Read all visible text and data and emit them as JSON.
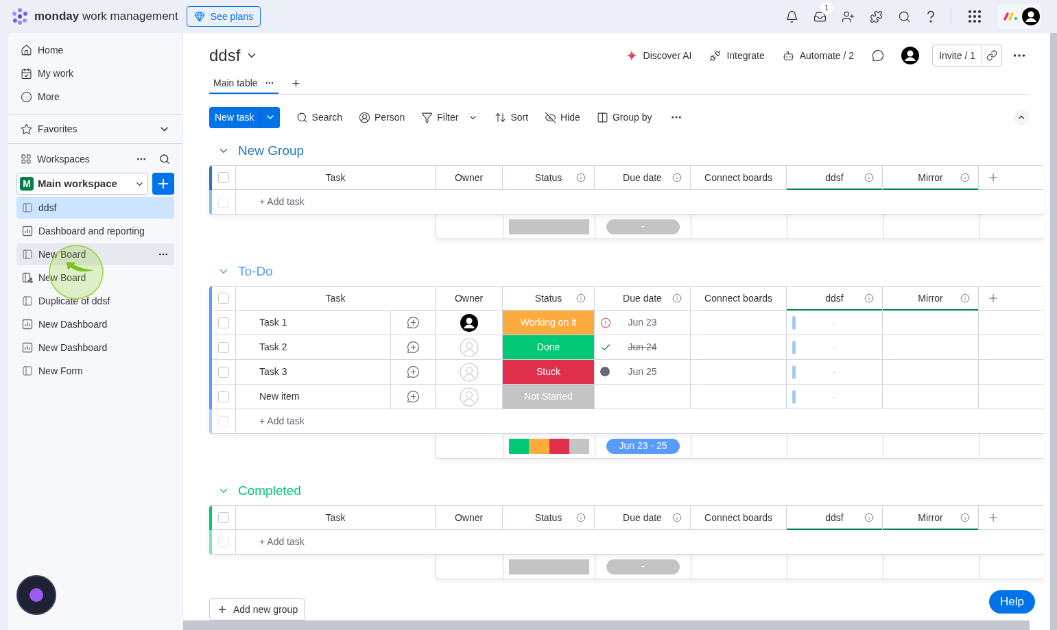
{
  "topbar": {
    "brand_bold": "monday",
    "brand_rest": "work management",
    "see_plans": "See plans",
    "inbox_badge": "1"
  },
  "sidebar": {
    "nav": [
      {
        "label": "Home",
        "kind": "home"
      },
      {
        "label": "My work",
        "kind": "mywork"
      },
      {
        "label": "More",
        "kind": "more"
      }
    ],
    "favorites": "Favorites",
    "workspaces": "Workspaces",
    "workspace": {
      "initial": "M",
      "name": "Main workspace"
    },
    "boards": [
      {
        "label": "ddsf",
        "kind": "board",
        "selected": true,
        "hovered": false
      },
      {
        "label": "Dashboard and reporting",
        "kind": "dashboard",
        "selected": false,
        "hovered": false
      },
      {
        "label": "New Board",
        "kind": "board",
        "selected": false,
        "hovered": true
      },
      {
        "label": "New Board",
        "kind": "shared",
        "selected": false,
        "hovered": false
      },
      {
        "label": "Duplicate of ddsf",
        "kind": "board",
        "selected": false,
        "hovered": false
      },
      {
        "label": "New Dashboard",
        "kind": "dashboard",
        "selected": false,
        "hovered": false
      },
      {
        "label": "New Dashboard",
        "kind": "dashboard",
        "selected": false,
        "hovered": false
      },
      {
        "label": "New Form",
        "kind": "board",
        "selected": false,
        "hovered": false
      }
    ]
  },
  "board": {
    "title": "ddsf",
    "actions": [
      {
        "label": "Discover AI",
        "kind": "ai"
      },
      {
        "label": "Integrate",
        "kind": "integrate"
      },
      {
        "label": "Automate / 2",
        "kind": "automate"
      }
    ],
    "invite": "Invite / 1",
    "tabs": [
      {
        "label": "Main table",
        "selected": true
      }
    ]
  },
  "toolbar": {
    "new_task": "New task",
    "tools": [
      {
        "label": "Search",
        "kind": "search"
      },
      {
        "label": "Person",
        "kind": "person"
      },
      {
        "label": "Filter",
        "kind": "filter"
      },
      {
        "label": "Sort",
        "kind": "sort"
      },
      {
        "label": "Hide",
        "kind": "hide"
      },
      {
        "label": "Group by",
        "kind": "groupby"
      }
    ]
  },
  "groups": [
    {
      "title": "New Group",
      "color": "#1f76c2",
      "all_checked": false,
      "add_row_disabled": true,
      "columns": [
        {
          "label": "Task",
          "info": false
        },
        {
          "label": "Owner",
          "info": false
        },
        {
          "label": "Status",
          "info": true
        },
        {
          "label": "Due date",
          "info": true
        },
        {
          "label": "Connect boards",
          "info": false
        },
        {
          "label": "ddsf",
          "info": true
        },
        {
          "label": "Mirror",
          "info": true
        }
      ],
      "add_task": "+ Add task",
      "summary": {
        "status_segments": [
          {
            "color": "#c4c4c4"
          }
        ],
        "date": {
          "label": "-",
          "color": "#c4c4c4"
        }
      }
    },
    {
      "title": "To-Do",
      "color": "#579bfc",
      "all_checked": false,
      "add_row_disabled": true,
      "columns": [
        {
          "label": "Task",
          "info": false
        },
        {
          "label": "Owner",
          "info": false
        },
        {
          "label": "Status",
          "info": true
        },
        {
          "label": "Due date",
          "info": true
        },
        {
          "label": "Connect boards",
          "info": false
        },
        {
          "label": "ddsf",
          "info": true
        },
        {
          "label": "Mirror",
          "info": true
        }
      ],
      "rows": [
        {
          "name": "Task 1",
          "checked": false,
          "owner": {
            "kind": "assigned"
          },
          "status": {
            "label": "Working on it",
            "color": "#fdab3d"
          },
          "due": {
            "date": "Jun 23",
            "strike": false,
            "indicator": {
              "kind": "overdue"
            }
          },
          "ddsf": "-"
        },
        {
          "name": "Task 2",
          "checked": false,
          "owner": {
            "kind": "unassigned"
          },
          "status": {
            "label": "Done",
            "color": "#00c875"
          },
          "due": {
            "date": "Jun 24",
            "strike": true,
            "indicator": {
              "kind": "done"
            }
          },
          "ddsf": "-"
        },
        {
          "name": "Task 3",
          "checked": false,
          "owner": {
            "kind": "unassigned"
          },
          "status": {
            "label": "Stuck",
            "color": "#df2f4a"
          },
          "due": {
            "date": "Jun 25",
            "strike": false,
            "indicator": {
              "kind": "dot"
            }
          },
          "ddsf": "-"
        },
        {
          "name": "New item",
          "checked": false,
          "owner": {
            "kind": "unassigned"
          },
          "status": {
            "label": "Not Started",
            "color": "#c4c4c4"
          },
          "ddsf": "-"
        }
      ],
      "add_task": "+ Add task",
      "summary": {
        "status_segments": [
          {
            "color": "#00c875"
          },
          {
            "color": "#fdab3d"
          },
          {
            "color": "#df2f4a"
          },
          {
            "color": "#c4c4c4"
          }
        ],
        "date": {
          "label": "Jun 23 - 25",
          "color": "#579bfc"
        }
      }
    },
    {
      "title": "Completed",
      "color": "#00c875",
      "all_checked": false,
      "add_row_disabled": true,
      "columns": [
        {
          "label": "Task",
          "info": false
        },
        {
          "label": "Owner",
          "info": false
        },
        {
          "label": "Status",
          "info": true
        },
        {
          "label": "Due date",
          "info": true
        },
        {
          "label": "Connect boards",
          "info": false
        },
        {
          "label": "ddsf",
          "info": true
        },
        {
          "label": "Mirror",
          "info": true
        }
      ],
      "add_task": "+ Add task",
      "summary": {
        "status_segments": [
          {
            "color": "#c4c4c4"
          }
        ],
        "date": {
          "label": "-",
          "color": "#c4c4c4"
        }
      }
    }
  ],
  "add_group": "Add new group",
  "help": "Help"
}
